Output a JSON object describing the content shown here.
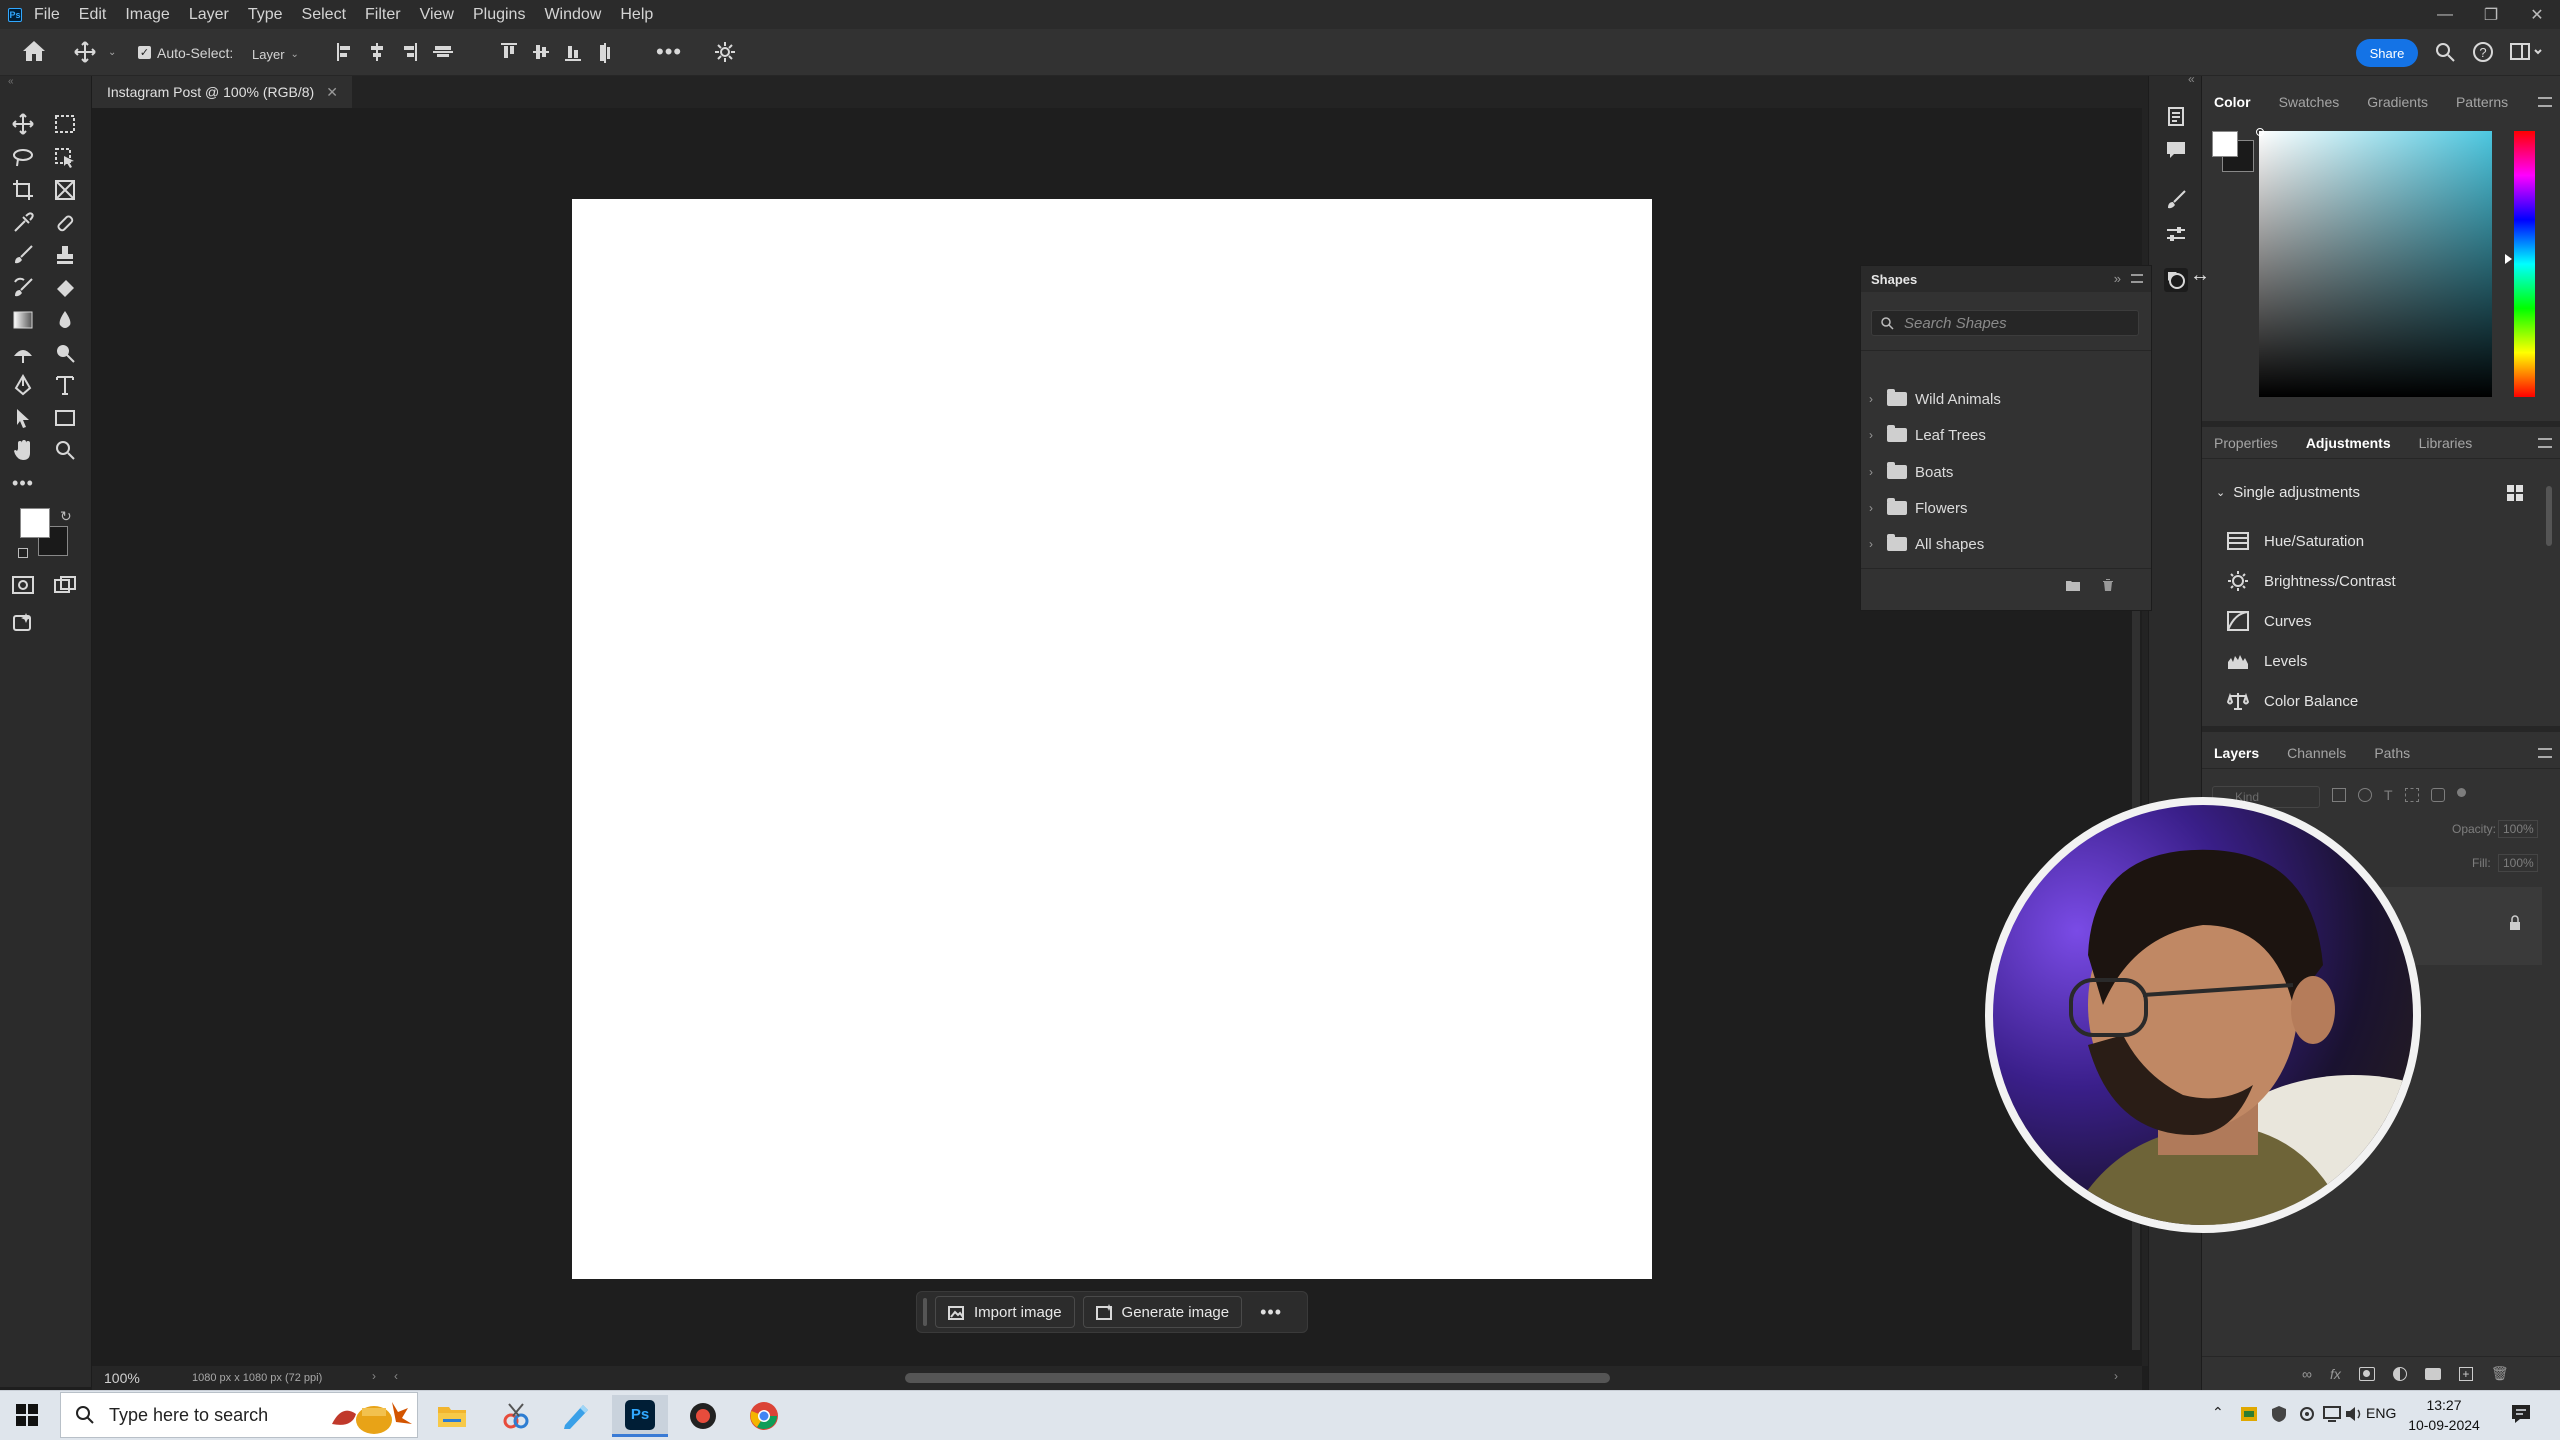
{
  "menu": {
    "items": [
      "File",
      "Edit",
      "Image",
      "Layer",
      "Type",
      "Select",
      "Filter",
      "View",
      "Plugins",
      "Window",
      "Help"
    ]
  },
  "options_bar": {
    "auto_select_label": "Auto-Select:",
    "auto_select_checked": true,
    "layer_select_value": "Layer",
    "share_label": "Share"
  },
  "document": {
    "tab_title": "Instagram Post @ 100% (RGB/8)",
    "zoom": "100%",
    "info": "1080 px x 1080 px (72 ppi)"
  },
  "contextual_bar": {
    "import_label": "Import image",
    "generate_label": "Generate image"
  },
  "shapes_panel": {
    "title": "Shapes",
    "search_placeholder": "Search Shapes",
    "folders": [
      "Wild Animals",
      "Leaf Trees",
      "Boats",
      "Flowers",
      "All shapes"
    ]
  },
  "color_panel": {
    "tabs": [
      "Color",
      "Swatches",
      "Gradients",
      "Patterns"
    ],
    "active_tab": "Color",
    "foreground": "#ffffff",
    "background": "#1a1a1a",
    "hue_color": "#4cc7e0"
  },
  "adjustments_panel": {
    "tabs": [
      "Properties",
      "Adjustments",
      "Libraries"
    ],
    "active_tab": "Adjustments",
    "section_title": "Single adjustments",
    "items": [
      "Hue/Saturation",
      "Brightness/Contrast",
      "Curves",
      "Levels",
      "Color Balance"
    ]
  },
  "layers_panel": {
    "tabs": [
      "Layers",
      "Channels",
      "Paths"
    ],
    "active_tab": "Layers",
    "kind_placeholder": "Kind",
    "opacity_label": "Opacity:",
    "opacity_value": "100%",
    "fill_label": "Fill:",
    "fill_value": "100%"
  },
  "taskbar": {
    "search_placeholder": "Type here to search",
    "language": "ENG",
    "time": "13:27",
    "date": "10-09-2024"
  }
}
